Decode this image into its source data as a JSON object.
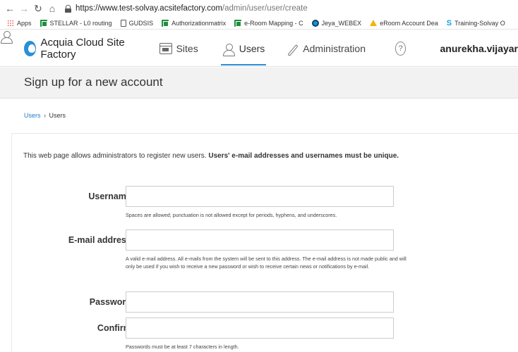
{
  "browser": {
    "url_host": "https://www.test-solvay.acsitefactory.com",
    "url_path": "/admin/user/user/create",
    "bookmarks": [
      {
        "label": "Apps",
        "icon": "apps-grid-icon"
      },
      {
        "label": "STELLAR - L0 routing",
        "icon": "sheets-icon"
      },
      {
        "label": "GUDSIS",
        "icon": "page-icon"
      },
      {
        "label": "Authorizationmatrix",
        "icon": "sheets-icon"
      },
      {
        "label": "e-Room Mapping - C",
        "icon": "sheets-icon"
      },
      {
        "label": "Jeya_WEBEX",
        "icon": "webex-icon"
      },
      {
        "label": "eRoom Account Dea",
        "icon": "drive-icon"
      },
      {
        "label": "Training-Solvay O",
        "icon": "s-icon"
      }
    ]
  },
  "header": {
    "brand": "Acquia Cloud Site Factory",
    "nav": {
      "sites": "Sites",
      "users": "Users",
      "administration": "Administration"
    },
    "help": "?",
    "account": "anurekha.vijayar"
  },
  "page": {
    "title": "Sign up for a new account",
    "breadcrumb": [
      "Users",
      "Users"
    ],
    "breadcrumb_sep": "›",
    "intro": "This web page allows administrators to register new users. ",
    "intro_bold": "Users' e-mail addresses and usernames must be unique."
  },
  "form": {
    "username": {
      "label": "Username:",
      "value": "",
      "help": "Spaces are allowed; punctuation is not allowed except for periods, hyphens, and underscores."
    },
    "email": {
      "label": "E-mail address:",
      "value": "",
      "help": "A valid e-mail address. All e-mails from the system will be sent to this address. The e-mail address is not made public and will only be used if you wish to receive a new password or wish to receive certain news or notifications by e-mail."
    },
    "password": {
      "label": "Password:",
      "value": ""
    },
    "confirm": {
      "label": "Confirm:",
      "value": "",
      "help": "Passwords must be at least 7 characters in length."
    }
  }
}
